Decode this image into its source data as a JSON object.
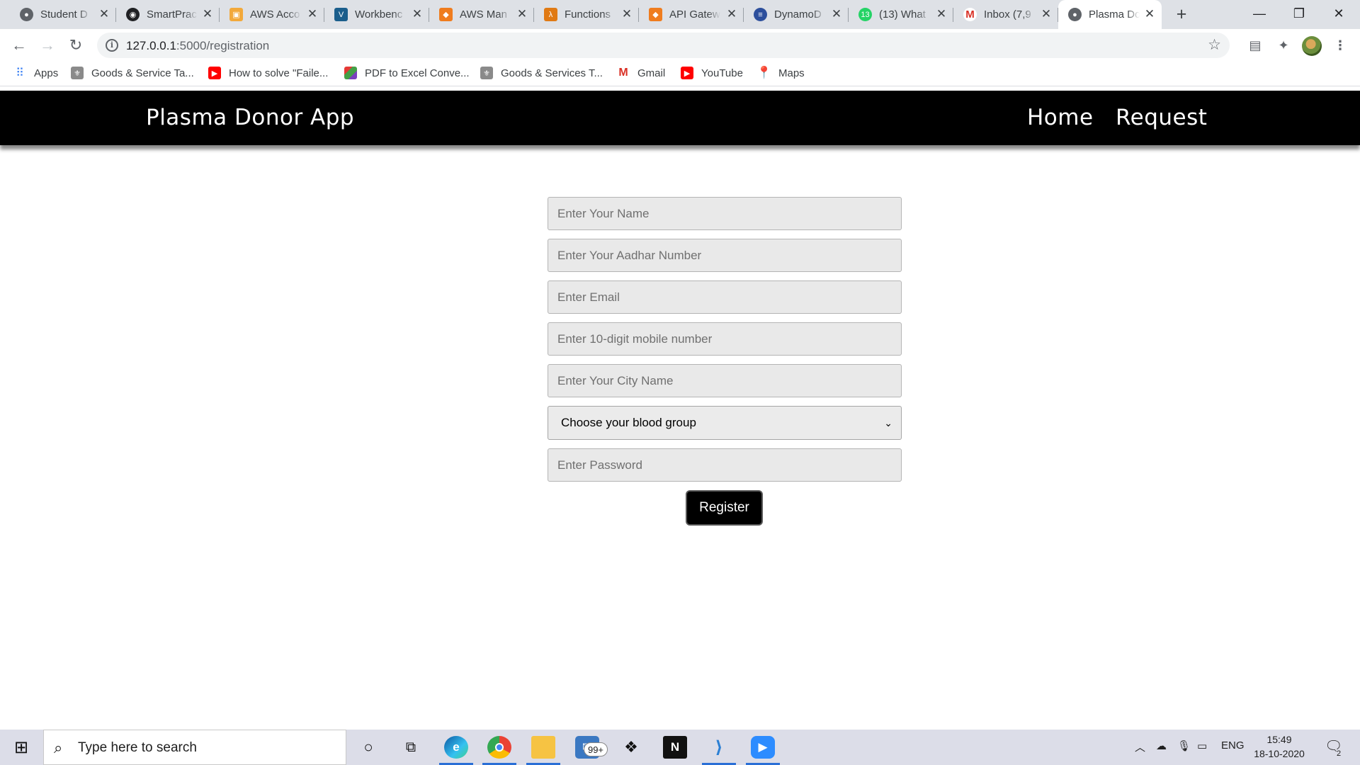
{
  "browser": {
    "tabs": [
      {
        "title": "Student D",
        "icon": "globe-icon",
        "color": "#5f6368"
      },
      {
        "title": "SmartPrac",
        "icon": "github-icon",
        "color": "#202124"
      },
      {
        "title": "AWS Acco",
        "icon": "aws-box-icon",
        "color": "#f2a93b"
      },
      {
        "title": "Workbenc",
        "icon": "v-icon",
        "color": "#1b5e8c"
      },
      {
        "title": "AWS Man",
        "icon": "aws-cube-icon",
        "color": "#ef7c1e"
      },
      {
        "title": "Functions",
        "icon": "lambda-icon",
        "color": "#e07a14"
      },
      {
        "title": "API Gatew",
        "icon": "aws-cube-icon",
        "color": "#ef7c1e"
      },
      {
        "title": "DynamoD",
        "icon": "dynamodb-icon",
        "color": "#2d4f9c"
      },
      {
        "title": "(13) What",
        "icon": "whatsapp-icon",
        "color": "#25d366"
      },
      {
        "title": "Inbox (7,9",
        "icon": "gmail-icon",
        "color": "#d93025"
      },
      {
        "title": "Plasma Do",
        "icon": "globe-icon",
        "color": "#5f6368"
      }
    ],
    "new_tab": "+",
    "url_host": "127.0.0.1",
    "url_path": ":5000/registration",
    "bookmarks": [
      {
        "label": "Apps",
        "icon": "apps-grid-icon",
        "color": "#4285f4"
      },
      {
        "label": "Goods & Service Ta...",
        "icon": "emblem-icon",
        "color": "#8a8a8a"
      },
      {
        "label": "How to solve \"Faile...",
        "icon": "youtube-icon",
        "color": "#ff0000"
      },
      {
        "label": "PDF to Excel Conve...",
        "icon": "pdf-excel-icon",
        "color": "#7b3fbf"
      },
      {
        "label": "Goods & Services T...",
        "icon": "emblem-icon",
        "color": "#8a8a8a"
      },
      {
        "label": "Gmail",
        "icon": "gmail-icon",
        "color": "#d93025"
      },
      {
        "label": "YouTube",
        "icon": "youtube-icon",
        "color": "#ff0000"
      },
      {
        "label": "Maps",
        "icon": "maps-pin-icon",
        "color": "#34a853"
      }
    ]
  },
  "app": {
    "brand": "Plasma Donor App",
    "nav": {
      "home": "Home",
      "request": "Request"
    }
  },
  "form": {
    "name_placeholder": "Enter Your Name",
    "aadhar_placeholder": "Enter Your Aadhar Number",
    "email_placeholder": "Enter Email",
    "mobile_placeholder": "Enter 10-digit mobile number",
    "city_placeholder": "Enter Your City Name",
    "blood_group_selected": "Choose your blood group",
    "password_placeholder": "Enter Password",
    "register_label": "Register"
  },
  "taskbar": {
    "search_placeholder": "Type here to search",
    "mail_badge": "99+",
    "language": "ENG",
    "time": "15:49",
    "date": "18-10-2020",
    "notification_count": "2"
  }
}
